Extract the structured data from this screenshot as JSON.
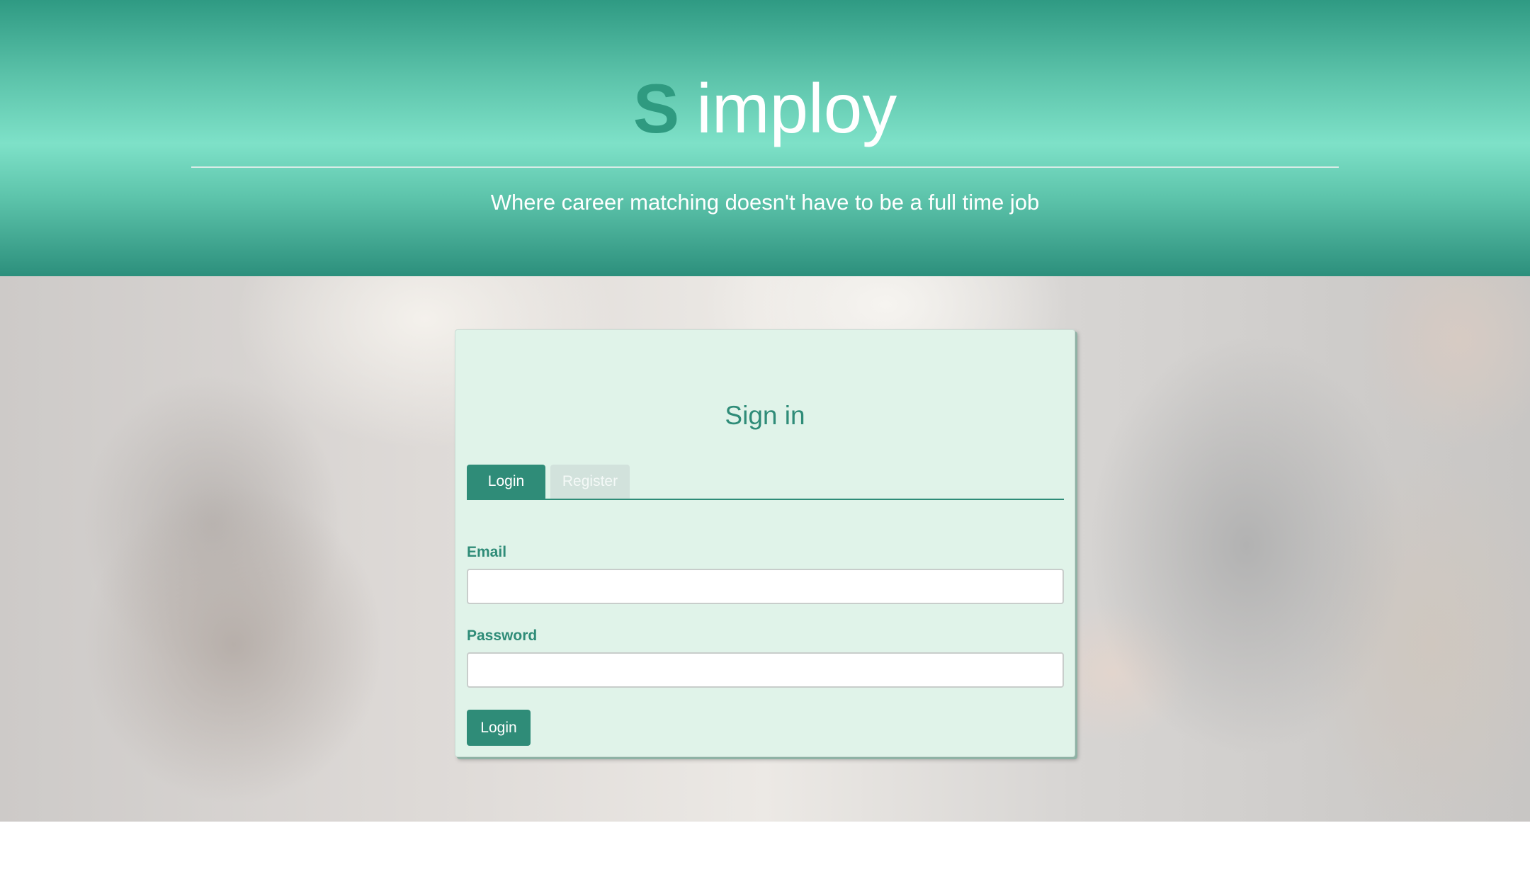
{
  "header": {
    "logo_letter": "S",
    "logo_text": "imploy",
    "tagline": "Where career matching doesn't have to be a full time job"
  },
  "signin": {
    "title": "Sign in",
    "tabs": [
      {
        "label": "Login",
        "active": true
      },
      {
        "label": "Register",
        "active": false
      }
    ],
    "email_label": "Email",
    "email_value": "",
    "password_label": "Password",
    "password_value": "",
    "submit_label": "Login"
  },
  "colors": {
    "brand_green": "#2f8c78",
    "header_light": "#7ee1c8",
    "card_bg": "#e0f3e9"
  }
}
